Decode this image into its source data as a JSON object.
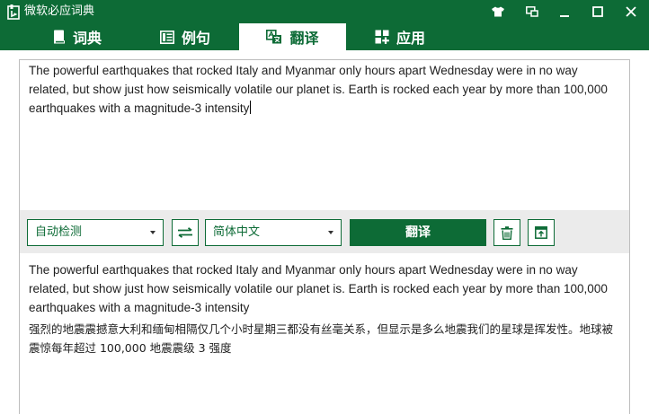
{
  "window": {
    "title": "微软必应词典",
    "colors": {
      "brand": "#0d6b36",
      "toolbar_bg": "#ebebeb",
      "text": "#1e1e1e"
    },
    "controls": [
      "skin-icon",
      "mini-mode-icon",
      "minimize-icon",
      "maximize-icon",
      "close-icon"
    ]
  },
  "tabs": [
    {
      "label": "词典",
      "icon": "book-icon",
      "active": false
    },
    {
      "label": "例句",
      "icon": "sentences-icon",
      "active": false
    },
    {
      "label": "翻译",
      "icon": "translate-icon",
      "active": true
    },
    {
      "label": "应用",
      "icon": "apps-icon",
      "active": false
    }
  ],
  "input": {
    "text": "The powerful earthquakes that rocked Italy and Myanmar only hours apart Wednesday were in no way related, but show just how seismically volatile our planet is. Earth is rocked each year by more than 100,000 earthquakes with a magnitude-3 intensity"
  },
  "toolbar": {
    "source_lang": "自动检测",
    "target_lang": "简体中文",
    "translate_label": "翻译"
  },
  "output": {
    "source_text": "The powerful earthquakes that rocked Italy and Myanmar only hours apart Wednesday were in no way related, but show just how seismically volatile our planet is. Earth is rocked each year by more than 100,000 earthquakes with a magnitude-3 intensity",
    "translation": "强烈的地震震撼意大利和缅甸相隔仅几个小时星期三都没有丝毫关系，但显示是多么地震我们的星球是挥发性。地球被震惊每年超过 100,000 地震震级 3 强度"
  }
}
